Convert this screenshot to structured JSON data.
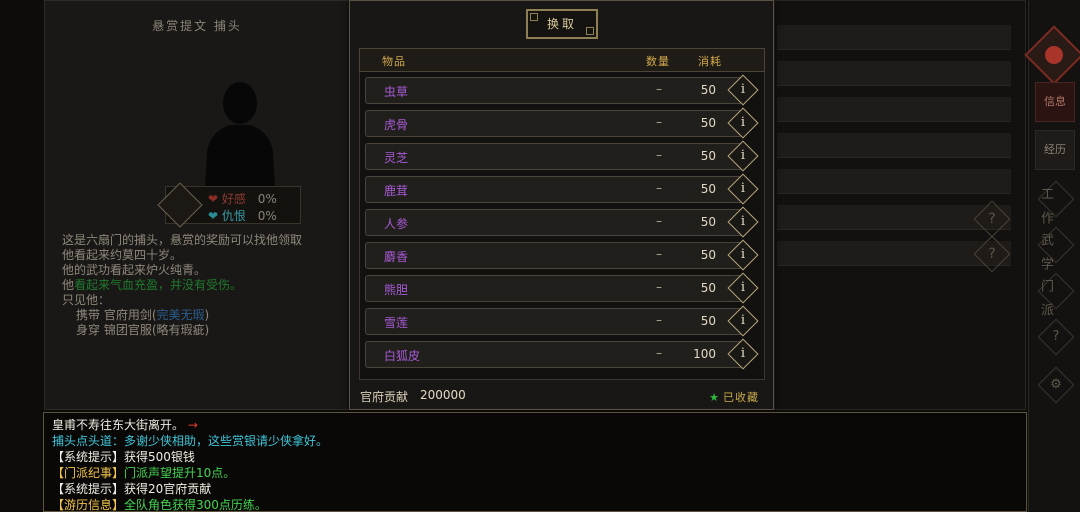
{
  "npc": {
    "title": "悬赏提文  捕头",
    "relations": [
      {
        "label": "好感",
        "value": "0%"
      },
      {
        "label": "仇恨",
        "value": "0%"
      }
    ],
    "desc": {
      "l1": "这是六扇门的捕头，悬赏的奖励可以找他领取",
      "l2": "他看起来约莫四十岁。",
      "l3": "他的武功看起来炉火纯青。",
      "l4a": "他",
      "l4b": "看起来气血充盈，并没有受伤。",
      "l5": "只见他：",
      "l6a": "携带  官府用剑(",
      "l6b": "完美无瑕",
      "l6c": ")",
      "l7": "身穿  锦团官服(略有瑕疵)"
    }
  },
  "side_nav": {
    "tabs": [
      "信息",
      "经历"
    ],
    "icons": [
      "工作",
      "武学",
      "门派",
      "?",
      "⚙"
    ]
  },
  "exchange": {
    "title": "换取",
    "columns": {
      "item": "物品",
      "qty": "数量",
      "cost": "消耗"
    },
    "items": [
      {
        "name": "虫草",
        "qty": "–",
        "cost": "50"
      },
      {
        "name": "虎骨",
        "qty": "–",
        "cost": "50"
      },
      {
        "name": "灵芝",
        "qty": "–",
        "cost": "50"
      },
      {
        "name": "鹿茸",
        "qty": "–",
        "cost": "50"
      },
      {
        "name": "人参",
        "qty": "–",
        "cost": "50"
      },
      {
        "name": "麝香",
        "qty": "–",
        "cost": "50"
      },
      {
        "name": "熊胆",
        "qty": "–",
        "cost": "50"
      },
      {
        "name": "雪莲",
        "qty": "–",
        "cost": "50"
      },
      {
        "name": "白狐皮",
        "qty": "–",
        "cost": "100"
      }
    ],
    "info_glyph": "i",
    "footer": {
      "contrib_label": "官府贡献",
      "contrib_value": "200000",
      "collected_label": "已收藏"
    }
  },
  "log": {
    "l1": "皇甫不寿往东大街离开。",
    "l1_arrow": "→",
    "l2": "捕头点头道：多谢少侠相助，这些赏银请少侠拿好。",
    "l3_tag": "【系统提示】",
    "l3_text": "获得500银钱",
    "l4_tag": "【门派纪事】",
    "l4_text": "门派声望提升10点。",
    "l5_tag": "【系统提示】",
    "l5_text": "获得20官府贡献",
    "l6_tag": "【游历信息】",
    "l6_text": "全队角色获得300点历练。"
  }
}
